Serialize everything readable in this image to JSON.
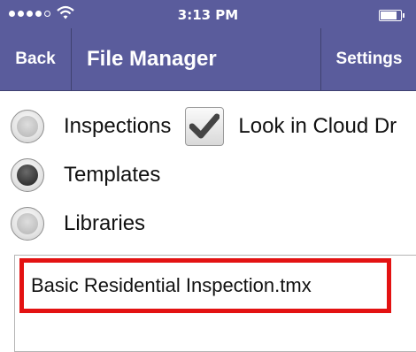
{
  "status_bar": {
    "time": "3:13 PM"
  },
  "nav": {
    "back_label": "Back",
    "title": "File Manager",
    "settings_label": "Settings"
  },
  "options": {
    "inspections_label": "Inspections",
    "cloud_label": "Look in Cloud Dr",
    "cloud_checked": true,
    "templates_label": "Templates",
    "libraries_label": "Libraries",
    "selected": "Templates"
  },
  "files": [
    {
      "name": "Basic Residential Inspection.tmx"
    }
  ],
  "colors": {
    "nav_background": "#5a5c9c",
    "highlight_border": "#e31212"
  }
}
